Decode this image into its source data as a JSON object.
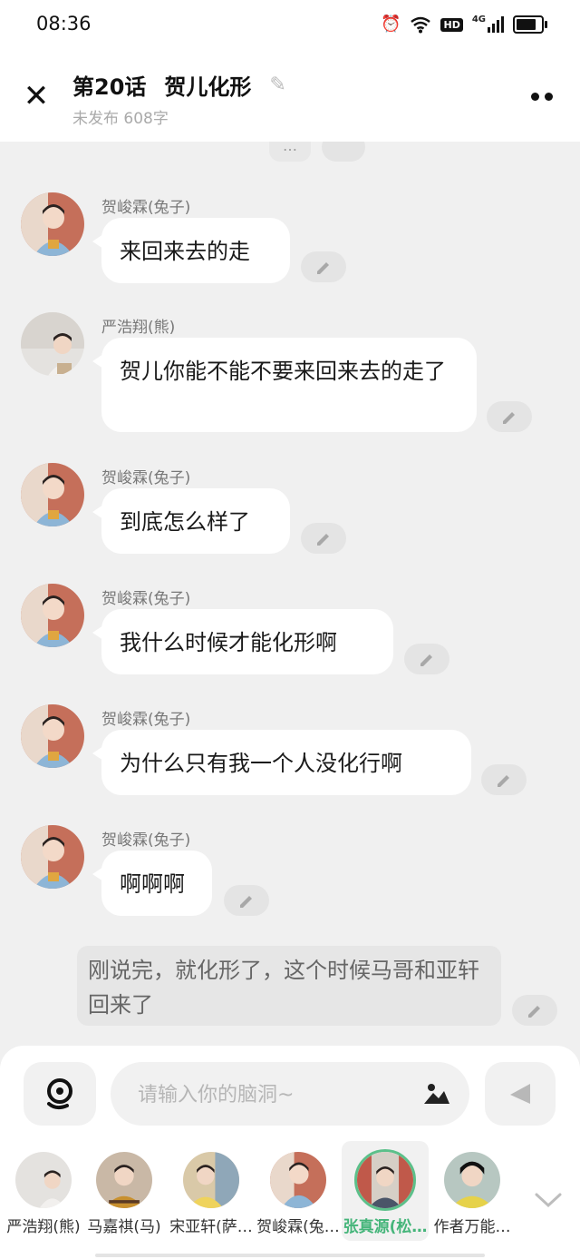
{
  "status_bar": {
    "time": "08:36",
    "network": "4G",
    "hd": "HD",
    "icons": [
      "alarm-icon",
      "wifi-icon",
      "hd-icon",
      "signal-icon",
      "battery-icon"
    ]
  },
  "header": {
    "title_chapter": "第20话",
    "title_name": "贺儿化形",
    "subtitle": "未发布 608字"
  },
  "messages": [
    {
      "sender": "贺峻霖(兔子)",
      "text": "来回来去的走"
    },
    {
      "sender": "严浩翔(熊)",
      "text": "贺儿你能不能不要来回来去的走了"
    },
    {
      "sender": "贺峻霖(兔子)",
      "text": "到底怎么样了"
    },
    {
      "sender": "贺峻霖(兔子)",
      "text": "我什么时候才能化形啊"
    },
    {
      "sender": "贺峻霖(兔子)",
      "text": "为什么只有我一个人没化行啊"
    },
    {
      "sender": "贺峻霖(兔子)",
      "text": "啊啊啊"
    }
  ],
  "narration": "刚说完，就化形了，这个时候马哥和亚轩回来了",
  "composer": {
    "placeholder": "请输入你的脑洞~"
  },
  "characters": [
    {
      "name": "严浩翔(熊)",
      "active": false
    },
    {
      "name": "马嘉祺(马)",
      "active": false
    },
    {
      "name": "宋亚轩(萨…",
      "active": false
    },
    {
      "name": "贺峻霖(兔…",
      "active": false
    },
    {
      "name": "张真源(松…",
      "active": true
    },
    {
      "name": "作者万能…",
      "active": false
    }
  ],
  "colors": {
    "accent_green": "#45b57a",
    "bubble_bg": "#ffffff",
    "page_bg": "#f0f0f0"
  }
}
